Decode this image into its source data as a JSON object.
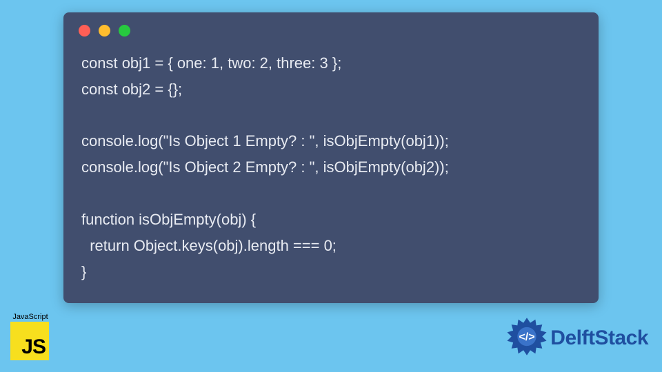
{
  "window": {
    "dots": [
      "red",
      "yellow",
      "green"
    ]
  },
  "code": {
    "l1": "const obj1 = { one: 1, two: 2, three: 3 };",
    "l2": "const obj2 = {};",
    "l3": "",
    "l4": "console.log(\"Is Object 1 Empty? : \", isObjEmpty(obj1));",
    "l5": "console.log(\"Is Object 2 Empty? : \", isObjEmpty(obj2));",
    "l6": "",
    "l7": "function isObjEmpty(obj) {",
    "l8": "  return Object.keys(obj).length === 0;",
    "l9": "}"
  },
  "badge": {
    "label": "JavaScript",
    "logo_text": "JS"
  },
  "brand": {
    "name": "DelftStack",
    "color": "#1f4fa0"
  },
  "colors": {
    "page_bg": "#6cc5ef",
    "window_bg": "#414e6e",
    "code_fg": "#e8ebf2",
    "js_yellow": "#f7df1e"
  }
}
